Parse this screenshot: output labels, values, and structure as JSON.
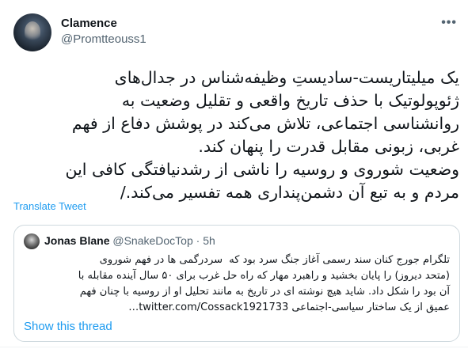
{
  "author": {
    "name": "Clamence",
    "handle": "@Promtteouss1"
  },
  "more_label": "•••",
  "tweet": {
    "text": "یک میلیتاریست-سادیستِ وظیفه‌شناس در جدال‌های\nژئوپولوتیک با حذف تاریخ واقعی و تقلیل وضعیت به\nروانشناسی اجتماعی، تلاش می‌کند در پوشش دفاع از فهم\nغربی، زبونی مقابل قدرت را پنهان کند.\nوضعیت شوروی و روسیه را ناشی از رشدنیافتگی کافی این\nمردم و به تبع آن دشمن‌پنداری همه تفسیر می‌کند./"
  },
  "translate_label": "Translate Tweet",
  "quote": {
    "name": "Jonas Blane",
    "handle": "@SnakeDocTop",
    "separator": " · ",
    "time": "5h",
    "text": "تلگرام جورج کنان سند رسمی آغاز جنگ سرد بود که  سردرگمی ها در فهم شوروی\n(متحد دیروز) را پایان بخشید و راهبرد مهار که راه حل غرب برای ۵۰ سال آینده مقابله با\nآن بود را شکل داد. شاید هیچ نوشته ای در تاریخ به مانند تحلیل او از روسیه با چنان فهم\nعمیق از یک ساختار سیاسی-اجتماعی twitter.com/Cossack1921733…",
    "show_thread_label": "Show this thread"
  },
  "colors": {
    "link": "#1d9bf0",
    "secondary_text": "#536471",
    "border": "#cfd9de"
  }
}
